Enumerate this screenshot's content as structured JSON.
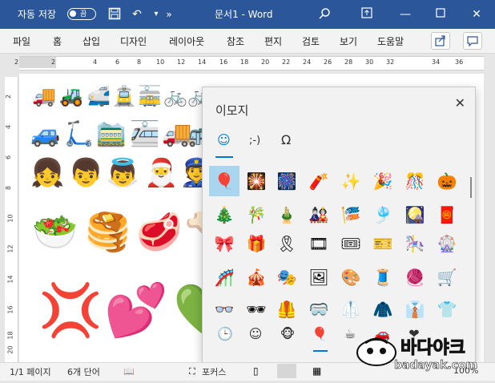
{
  "titlebar": {
    "autosave_label": "자동 저장",
    "autosave_state": "끔",
    "title": "문서1  -  Word",
    "colors": {
      "brand": "#2b579a"
    }
  },
  "menu": {
    "items": [
      "파일",
      "홈",
      "삽입",
      "디자인",
      "레이아웃",
      "참조",
      "편지",
      "검토",
      "보기",
      "도움말"
    ]
  },
  "ruler": {
    "numbers": [
      "2",
      "2",
      "4",
      "6",
      "8",
      "10",
      "12",
      "14",
      "16",
      "18",
      "20",
      "22",
      "24",
      "26",
      "28",
      "30",
      "32",
      "34",
      "36"
    ],
    "vertical_numbers": [
      "2",
      "4",
      "6",
      "8",
      "10",
      "12",
      "14",
      "16",
      "18",
      "20"
    ]
  },
  "document": {
    "rows": [
      [
        "🚚",
        "🚜",
        "🚅",
        "🚊",
        "🚋",
        "🚲",
        "🚲"
      ],
      [
        "🚙",
        "🛴",
        "🚞",
        "🚈",
        "🚚",
        "🚌"
      ],
      [
        "👧",
        "👦",
        "👼",
        "🎅",
        "👮"
      ],
      [
        "🥗",
        "🥞",
        "🥩",
        "🦴"
      ],
      [
        "💢",
        "💕",
        "💚"
      ]
    ]
  },
  "emoji_panel": {
    "title": "이모지",
    "category_tabs": [
      "☺",
      ";-)",
      "Ω"
    ],
    "grid": [
      [
        "🎈",
        "🎇",
        "🎆",
        "🧨",
        "✨",
        "🎉",
        "🎊",
        "🎃"
      ],
      [
        "🎄",
        "🎋",
        "🎍",
        "🎎",
        "🎏",
        "🎐",
        "🎑",
        "🧧"
      ],
      [
        "🎀",
        "🎁",
        "🎗",
        "🎞",
        "🎟",
        "🎫",
        "🎠",
        "🎡"
      ],
      [
        "🎢",
        "🎪",
        "🎭",
        "🖼",
        "🎨",
        "🧵",
        "🧶",
        "🛒"
      ],
      [
        "👓",
        "🕶",
        "🦺",
        "🥽",
        "🥼",
        "🧥",
        "👔",
        "👕"
      ]
    ],
    "bottom_tabs": [
      "🕒",
      "☺",
      "🐵",
      "🎈",
      "☕",
      "🚗",
      "❤"
    ]
  },
  "status": {
    "page": "1/1 페이지",
    "words": "6개 단어",
    "focus": "포커스",
    "zoom": "100%"
  },
  "watermark": {
    "text": "바다야크",
    "domain": "badayak.com"
  }
}
